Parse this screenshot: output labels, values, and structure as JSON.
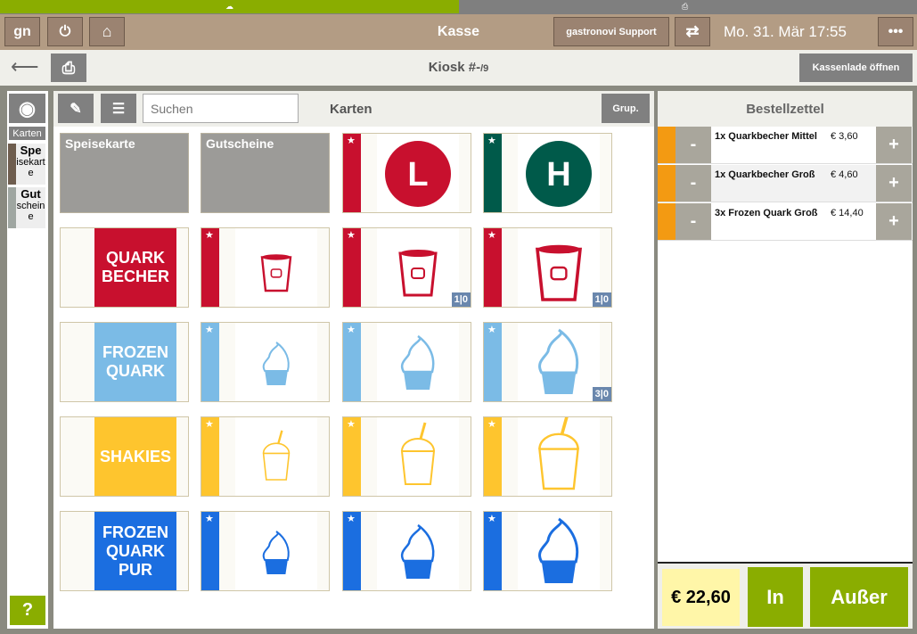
{
  "header": {
    "title": "Kasse",
    "support": "gastronovi Support",
    "datetime": "Mo. 31. Mär 17:55",
    "logo": "gn"
  },
  "subheader": {
    "title": "Kiosk #-",
    "suffix": "/9",
    "cash_drawer": "Kassenlade öffnen"
  },
  "sidebar": {
    "section": "Karten",
    "items": [
      {
        "bold": "Spe",
        "rest": "isekarte",
        "color": "#6e5d4e"
      },
      {
        "bold": "Gut",
        "rest": "scheine",
        "color": "#9fa6a1"
      }
    ],
    "help": "?"
  },
  "main": {
    "search_placeholder": "Suchen",
    "title": "Karten",
    "group": "Grup.",
    "categories": [
      "Speisekarte",
      "Gutscheine"
    ],
    "brand_tiles": [
      {
        "text": "QUARK BECHER",
        "color": "#c8102e"
      },
      {
        "text": "FROZEN QUARK",
        "color": "#7bbbe6"
      },
      {
        "text": "SHAKIES",
        "color": "#fec52e"
      },
      {
        "text": "FROZEN QUARK PUR",
        "color": "#1b6ee0"
      }
    ],
    "badges": {
      "r1c2": "1|0",
      "r1c3": "1|0",
      "r2c3": "3|0"
    },
    "logo_tiles": [
      {
        "letter": "L",
        "color": "#c8102e"
      },
      {
        "letter": "H",
        "color": "#005a4a"
      }
    ]
  },
  "order": {
    "title": "Bestellzettel",
    "items": [
      {
        "name": "1x Quarkbecher Mittel",
        "price": "€ 3,60"
      },
      {
        "name": "1x Quarkbecher Groß",
        "price": "€ 4,60"
      },
      {
        "name": "3x Frozen Quark Groß",
        "price": "€ 14,40"
      }
    ],
    "total": "€ 22,60",
    "in": "In",
    "out": "Außer",
    "minus": "-",
    "plus": "+"
  }
}
